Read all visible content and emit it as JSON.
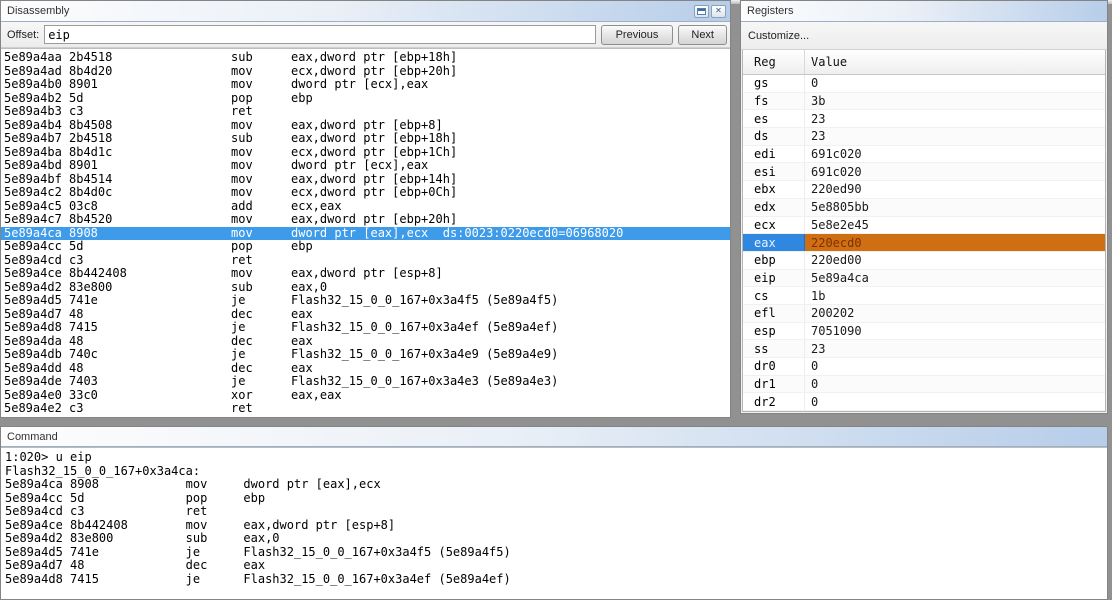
{
  "colors": {
    "selection_blue": "#3d9be9",
    "selected_reg_name_bg": "#2f87e0",
    "selected_reg_value_bg": "#d06e14"
  },
  "disassembly": {
    "title": "Disassembly",
    "close_glyph": "✕",
    "offset_label": "Offset:",
    "offset_value": "eip",
    "previous_button": "Previous",
    "next_button": "Next",
    "highlighted_address": "5e89a4ca",
    "lines": [
      {
        "addr": "5e89a4aa",
        "bytes": "2b4518",
        "mnemonic": "sub",
        "operands": "eax,dword ptr [ebp+18h]",
        "highlight": false
      },
      {
        "addr": "5e89a4ad",
        "bytes": "8b4d20",
        "mnemonic": "mov",
        "operands": "ecx,dword ptr [ebp+20h]",
        "highlight": false
      },
      {
        "addr": "5e89a4b0",
        "bytes": "8901",
        "mnemonic": "mov",
        "operands": "dword ptr [ecx],eax",
        "highlight": false
      },
      {
        "addr": "5e89a4b2",
        "bytes": "5d",
        "mnemonic": "pop",
        "operands": "ebp",
        "highlight": false
      },
      {
        "addr": "5e89a4b3",
        "bytes": "c3",
        "mnemonic": "ret",
        "operands": "",
        "highlight": false
      },
      {
        "addr": "5e89a4b4",
        "bytes": "8b4508",
        "mnemonic": "mov",
        "operands": "eax,dword ptr [ebp+8]",
        "highlight": false
      },
      {
        "addr": "5e89a4b7",
        "bytes": "2b4518",
        "mnemonic": "sub",
        "operands": "eax,dword ptr [ebp+18h]",
        "highlight": false
      },
      {
        "addr": "5e89a4ba",
        "bytes": "8b4d1c",
        "mnemonic": "mov",
        "operands": "ecx,dword ptr [ebp+1Ch]",
        "highlight": false
      },
      {
        "addr": "5e89a4bd",
        "bytes": "8901",
        "mnemonic": "mov",
        "operands": "dword ptr [ecx],eax",
        "highlight": false
      },
      {
        "addr": "5e89a4bf",
        "bytes": "8b4514",
        "mnemonic": "mov",
        "operands": "eax,dword ptr [ebp+14h]",
        "highlight": false
      },
      {
        "addr": "5e89a4c2",
        "bytes": "8b4d0c",
        "mnemonic": "mov",
        "operands": "ecx,dword ptr [ebp+0Ch]",
        "highlight": false
      },
      {
        "addr": "5e89a4c5",
        "bytes": "03c8",
        "mnemonic": "add",
        "operands": "ecx,eax",
        "highlight": false
      },
      {
        "addr": "5e89a4c7",
        "bytes": "8b4520",
        "mnemonic": "mov",
        "operands": "eax,dword ptr [ebp+20h]",
        "highlight": false
      },
      {
        "addr": "5e89a4ca",
        "bytes": "8908",
        "mnemonic": "mov",
        "operands": "dword ptr [eax],ecx  ds:0023:0220ecd0=06968020",
        "highlight": true
      },
      {
        "addr": "5e89a4cc",
        "bytes": "5d",
        "mnemonic": "pop",
        "operands": "ebp",
        "highlight": false
      },
      {
        "addr": "5e89a4cd",
        "bytes": "c3",
        "mnemonic": "ret",
        "operands": "",
        "highlight": false
      },
      {
        "addr": "5e89a4ce",
        "bytes": "8b442408",
        "mnemonic": "mov",
        "operands": "eax,dword ptr [esp+8]",
        "highlight": false
      },
      {
        "addr": "5e89a4d2",
        "bytes": "83e800",
        "mnemonic": "sub",
        "operands": "eax,0",
        "highlight": false
      },
      {
        "addr": "5e89a4d5",
        "bytes": "741e",
        "mnemonic": "je",
        "operands": "Flash32_15_0_0_167+0x3a4f5 (5e89a4f5)",
        "highlight": false
      },
      {
        "addr": "5e89a4d7",
        "bytes": "48",
        "mnemonic": "dec",
        "operands": "eax",
        "highlight": false
      },
      {
        "addr": "5e89a4d8",
        "bytes": "7415",
        "mnemonic": "je",
        "operands": "Flash32_15_0_0_167+0x3a4ef (5e89a4ef)",
        "highlight": false
      },
      {
        "addr": "5e89a4da",
        "bytes": "48",
        "mnemonic": "dec",
        "operands": "eax",
        "highlight": false
      },
      {
        "addr": "5e89a4db",
        "bytes": "740c",
        "mnemonic": "je",
        "operands": "Flash32_15_0_0_167+0x3a4e9 (5e89a4e9)",
        "highlight": false
      },
      {
        "addr": "5e89a4dd",
        "bytes": "48",
        "mnemonic": "dec",
        "operands": "eax",
        "highlight": false
      },
      {
        "addr": "5e89a4de",
        "bytes": "7403",
        "mnemonic": "je",
        "operands": "Flash32_15_0_0_167+0x3a4e3 (5e89a4e3)",
        "highlight": false
      },
      {
        "addr": "5e89a4e0",
        "bytes": "33c0",
        "mnemonic": "xor",
        "operands": "eax,eax",
        "highlight": false
      },
      {
        "addr": "5e89a4e2",
        "bytes": "c3",
        "mnemonic": "ret",
        "operands": "",
        "highlight": false
      }
    ]
  },
  "registers": {
    "title": "Registers",
    "customize_label": "Customize...",
    "columns": {
      "reg": "Reg",
      "value": "Value"
    },
    "selected_reg": "eax",
    "rows": [
      {
        "reg": "gs",
        "value": "0"
      },
      {
        "reg": "fs",
        "value": "3b"
      },
      {
        "reg": "es",
        "value": "23"
      },
      {
        "reg": "ds",
        "value": "23"
      },
      {
        "reg": "edi",
        "value": "691c020"
      },
      {
        "reg": "esi",
        "value": "691c020"
      },
      {
        "reg": "ebx",
        "value": "220ed90"
      },
      {
        "reg": "edx",
        "value": "5e8805bb"
      },
      {
        "reg": "ecx",
        "value": "5e8e2e45"
      },
      {
        "reg": "eax",
        "value": "220ecd0"
      },
      {
        "reg": "ebp",
        "value": "220ed00"
      },
      {
        "reg": "eip",
        "value": "5e89a4ca"
      },
      {
        "reg": "cs",
        "value": "1b"
      },
      {
        "reg": "efl",
        "value": "200202"
      },
      {
        "reg": "esp",
        "value": "7051090"
      },
      {
        "reg": "ss",
        "value": "23"
      },
      {
        "reg": "dr0",
        "value": "0"
      },
      {
        "reg": "dr1",
        "value": "0"
      },
      {
        "reg": "dr2",
        "value": "0"
      }
    ]
  },
  "command": {
    "title": "Command",
    "lines": [
      "1:020> u eip",
      "Flash32_15_0_0_167+0x3a4ca:",
      "5e89a4ca 8908            mov     dword ptr [eax],ecx",
      "5e89a4cc 5d              pop     ebp",
      "5e89a4cd c3              ret",
      "5e89a4ce 8b442408        mov     eax,dword ptr [esp+8]",
      "5e89a4d2 83e800          sub     eax,0",
      "5e89a4d5 741e            je      Flash32_15_0_0_167+0x3a4f5 (5e89a4f5)",
      "5e89a4d7 48              dec     eax",
      "5e89a4d8 7415            je      Flash32_15_0_0_167+0x3a4ef (5e89a4ef)"
    ]
  }
}
